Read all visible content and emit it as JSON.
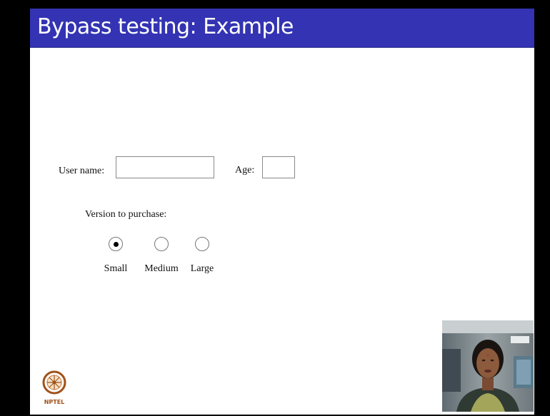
{
  "slide": {
    "title": "Bypass testing: Example"
  },
  "form": {
    "username_label": "User name:",
    "username_value": "",
    "age_label": "Age:",
    "age_value": "",
    "version_label": "Version to purchase:",
    "options": [
      {
        "label": "Small",
        "selected": true
      },
      {
        "label": "Medium",
        "selected": false
      },
      {
        "label": "Large",
        "selected": false
      }
    ]
  },
  "logo": {
    "text": "NPTEL",
    "icon": "nptel-logo-icon"
  },
  "video": {
    "icon": "presenter-video-feed"
  },
  "colors": {
    "title_bar": "#3333b3",
    "slide_bg": "#ffffff",
    "frame_bg": "#000000",
    "logo": "#a0521a"
  }
}
